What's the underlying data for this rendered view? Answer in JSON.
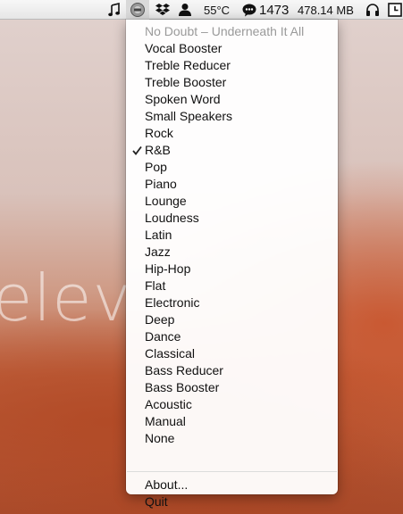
{
  "desktop": {
    "watermark_text": "elev"
  },
  "menubar": {
    "temperature": "55°C",
    "count": "1473",
    "memory": "478.14 MB",
    "icons": [
      "music-note-icon",
      "equalizer-app-icon",
      "dropbox-icon",
      "user-icon",
      "chat-bubble-icon",
      "headphones-icon",
      "clock-icon"
    ]
  },
  "menu": {
    "now_playing": "No Doubt – Underneath It All",
    "presets": [
      {
        "label": "Vocal Booster",
        "checked": false
      },
      {
        "label": "Treble Reducer",
        "checked": false
      },
      {
        "label": "Treble Booster",
        "checked": false
      },
      {
        "label": "Spoken Word",
        "checked": false
      },
      {
        "label": "Small Speakers",
        "checked": false
      },
      {
        "label": "Rock",
        "checked": false
      },
      {
        "label": "R&B",
        "checked": true
      },
      {
        "label": "Pop",
        "checked": false
      },
      {
        "label": "Piano",
        "checked": false
      },
      {
        "label": "Lounge",
        "checked": false
      },
      {
        "label": "Loudness",
        "checked": false
      },
      {
        "label": "Latin",
        "checked": false
      },
      {
        "label": "Jazz",
        "checked": false
      },
      {
        "label": "Hip-Hop",
        "checked": false
      },
      {
        "label": "Flat",
        "checked": false
      },
      {
        "label": "Electronic",
        "checked": false
      },
      {
        "label": "Deep",
        "checked": false
      },
      {
        "label": "Dance",
        "checked": false
      },
      {
        "label": "Classical",
        "checked": false
      },
      {
        "label": "Bass Reducer",
        "checked": false
      },
      {
        "label": "Bass Booster",
        "checked": false
      },
      {
        "label": "Acoustic",
        "checked": false
      },
      {
        "label": "Manual",
        "checked": false
      },
      {
        "label": "None",
        "checked": false
      }
    ],
    "about_label": "About...",
    "quit_label": "Quit"
  }
}
